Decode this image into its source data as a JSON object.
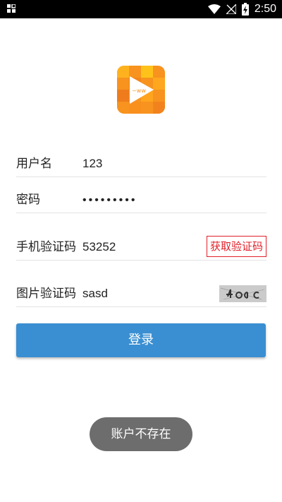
{
  "status_bar": {
    "time": "2:50",
    "icons": [
      "grid-icon",
      "wifi-icon",
      "no-signal-icon",
      "battery-charging-icon"
    ]
  },
  "app_logo": {
    "icon": "video-play-app-icon",
    "colors": {
      "primary": "#f7931e",
      "secondary": "#ffc21a"
    }
  },
  "form": {
    "username": {
      "label": "用户名",
      "value": "123"
    },
    "password": {
      "label": "密码",
      "value": "•••••••••"
    },
    "sms_code": {
      "label": "手机验证码",
      "value": "53252",
      "button_label": "获取验证码"
    },
    "image_code": {
      "label": "图片验证码",
      "value": "sasd",
      "captcha_icon": "captcha-image"
    }
  },
  "login_button": {
    "label": "登录",
    "color": "#3a8fd2"
  },
  "toast": {
    "text": "账户不存在"
  },
  "colors": {
    "accent": "#3a8fd2",
    "danger": "#e0202a",
    "toast_bg": "#6d6d6d"
  }
}
